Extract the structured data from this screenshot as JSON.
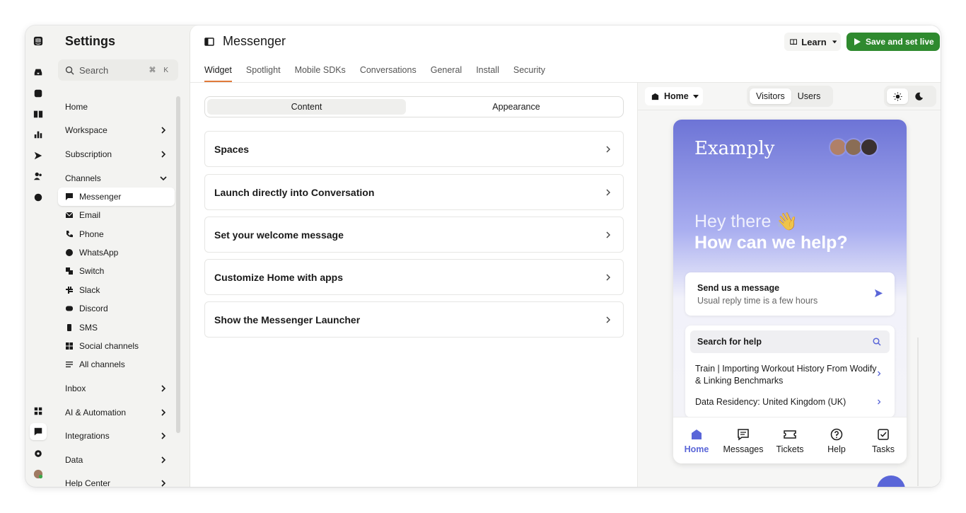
{
  "sidebar_title": "Settings",
  "search": {
    "placeholder": "Search",
    "shortcut": "⌘ K"
  },
  "nav": [
    {
      "label": "Home"
    },
    {
      "label": "Workspace"
    },
    {
      "label": "Subscription"
    },
    {
      "label": "Channels"
    },
    {
      "label": "Messenger"
    },
    {
      "label": "Email"
    },
    {
      "label": "Phone"
    },
    {
      "label": "WhatsApp"
    },
    {
      "label": "Switch"
    },
    {
      "label": "Slack"
    },
    {
      "label": "Discord"
    },
    {
      "label": "SMS"
    },
    {
      "label": "Social channels"
    },
    {
      "label": "All channels"
    },
    {
      "label": "Inbox"
    },
    {
      "label": "AI & Automation"
    },
    {
      "label": "Integrations"
    },
    {
      "label": "Data"
    },
    {
      "label": "Help Center"
    }
  ],
  "header": {
    "title": "Messenger",
    "learn": "Learn",
    "save": "Save and set live"
  },
  "tabs": [
    "Widget",
    "Spotlight",
    "Mobile SDKs",
    "Conversations",
    "General",
    "Install",
    "Security"
  ],
  "segment": {
    "content": "Content",
    "appearance": "Appearance"
  },
  "cards": [
    "Spaces",
    "Launch directly into Conversation",
    "Set your welcome message",
    "Customize Home with apps",
    "Show the Messenger Launcher"
  ],
  "preview": {
    "home_select": "Home",
    "visitors": "Visitors",
    "users": "Users",
    "brand": "Examply",
    "greeting": "Hey there 👋",
    "question": "How can we help?",
    "send_title": "Send us a message",
    "send_sub": "Usual reply time is a few hours",
    "search_help": "Search for help",
    "articles": [
      "Train | Importing Workout History From Wodify & Linking Benchmarks",
      "Data Residency: United Kingdom (UK)"
    ],
    "nav": [
      "Home",
      "Messages",
      "Tickets",
      "Help",
      "Tasks"
    ]
  },
  "colors": {
    "accent": "#5a66d8",
    "save": "#2f8a2f",
    "tab_underline": "#e07a3a"
  }
}
